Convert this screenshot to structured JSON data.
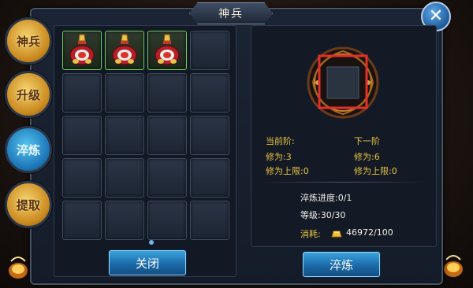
{
  "window": {
    "title": "神兵",
    "close_icon": "close-x-icon"
  },
  "side_tabs": [
    {
      "label": "神兵",
      "style": "gold"
    },
    {
      "label": "升级",
      "style": "gold"
    },
    {
      "label": "淬炼",
      "style": "blue"
    },
    {
      "label": "提取",
      "style": "gold"
    }
  ],
  "inventory": {
    "filled_slots": 3,
    "total_slots": 20,
    "item_icon": "red-gourd-item-icon"
  },
  "buttons": {
    "close_label": "关闭",
    "refine_label": "淬炼"
  },
  "stats": {
    "current_label": "当前阶:",
    "next_label": "下一阶",
    "current_xiuwei": "修为:3",
    "current_cap": "修为上限:0",
    "next_xiuwei": "修为:6",
    "next_cap": "修为上限:0"
  },
  "progress": {
    "refine_progress": "淬炼进度:0/1",
    "level": "等级:30/30",
    "cost_label": "消耗:",
    "cost_value": "46972/100",
    "cost_icon": "gold-ingot-icon"
  },
  "colors": {
    "accent_yellow": "#e9c341",
    "button_blue": "#1b6aa8",
    "highlight_red": "#e0302a",
    "filled_slot_border": "#6fcc5a"
  }
}
